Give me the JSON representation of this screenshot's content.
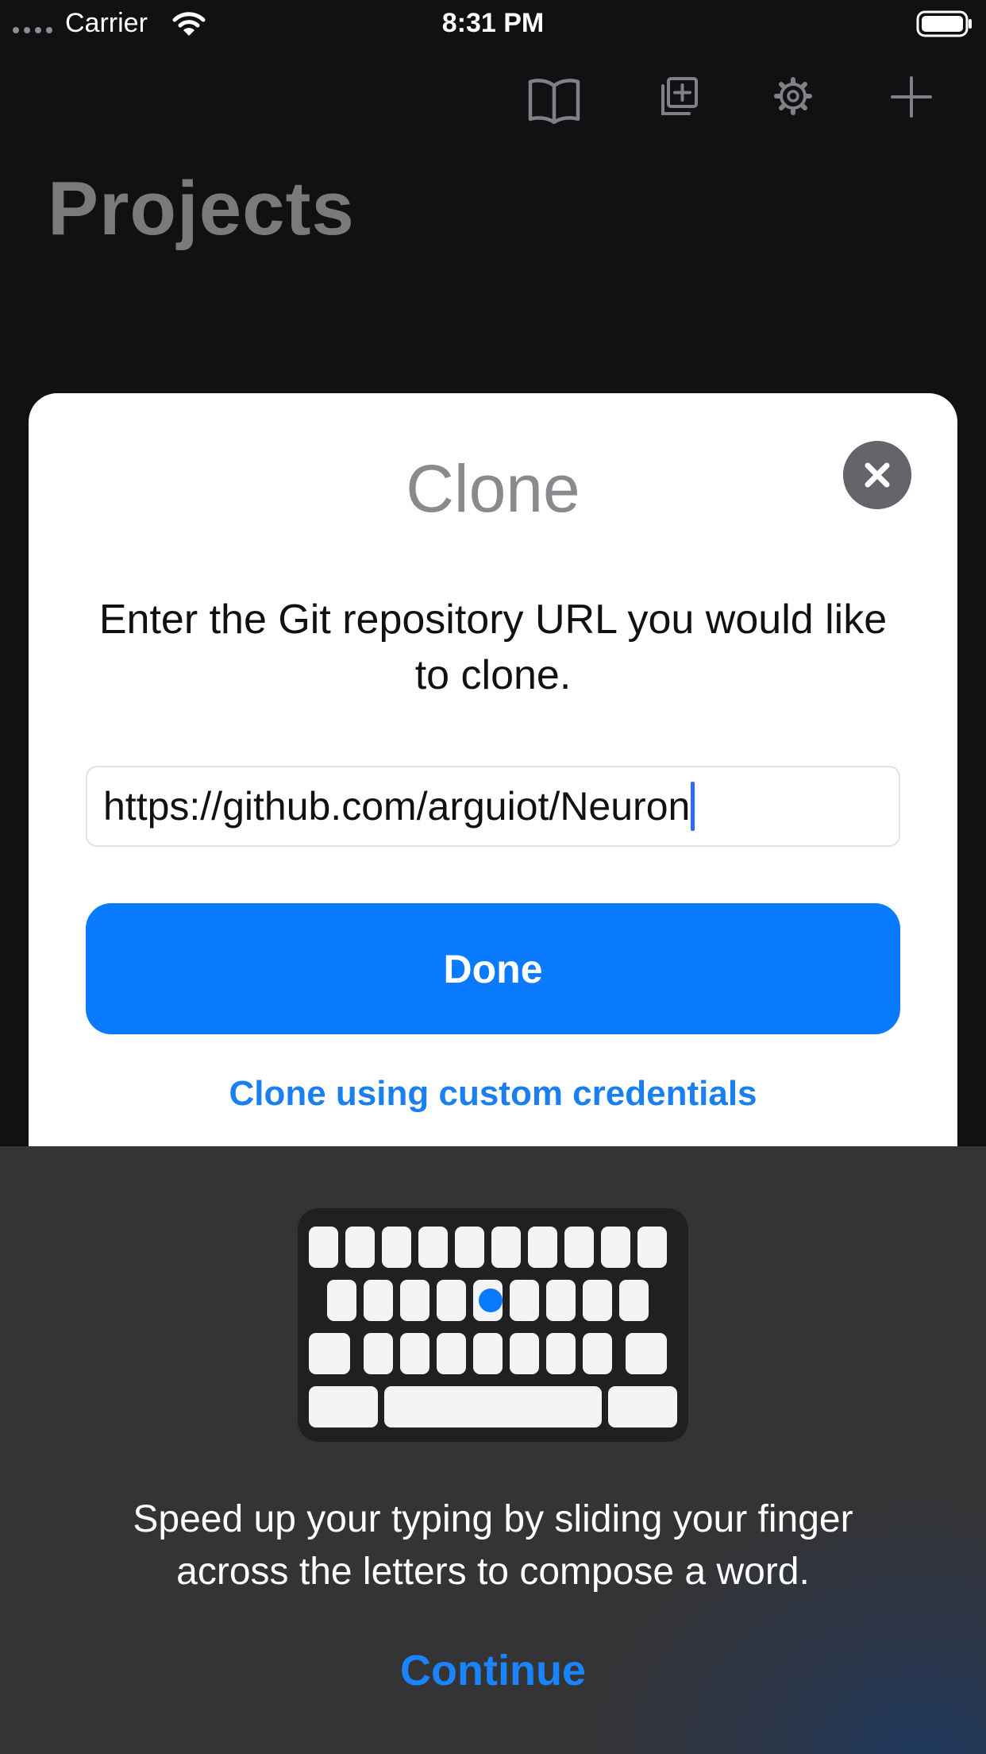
{
  "status_bar": {
    "carrier": "Carrier",
    "time": "8:31 PM"
  },
  "toolbar": {
    "icons": [
      "book-icon",
      "add-copy-icon",
      "gear-icon",
      "plus-icon"
    ]
  },
  "page_title": "Projects",
  "clone_sheet": {
    "title": "Clone",
    "message": "Enter the Git repository URL you would like to clone.",
    "url_value": "https://github.com/arguiot/Neuron",
    "done_label": "Done",
    "custom_credentials_label": "Clone using custom credentials"
  },
  "keyboard_tip": {
    "message": "Speed up your typing by sliding your finger across the letters to compose a word.",
    "continue_label": "Continue"
  },
  "colors": {
    "accent": "#0A7BFF",
    "background": "#111113",
    "sheet": "#FFFFFF",
    "tip_panel": "#343436"
  }
}
